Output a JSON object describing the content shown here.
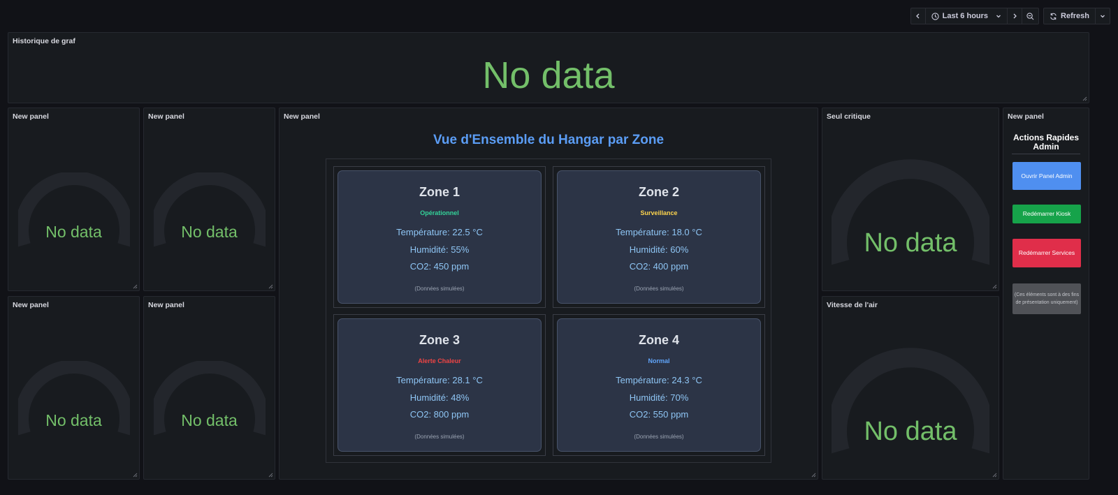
{
  "toolbar": {
    "time_range": "Last 6 hours",
    "refresh_label": "Refresh"
  },
  "no_data": "No data",
  "panels": {
    "history": {
      "title": "Historique de graf"
    },
    "gauge1": {
      "title": "New panel"
    },
    "gauge2": {
      "title": "New panel"
    },
    "gauge3": {
      "title": "New panel"
    },
    "gauge4": {
      "title": "New panel"
    },
    "overview": {
      "title": "New panel"
    },
    "critical": {
      "title": "Seul critique"
    },
    "airspeed": {
      "title": "Vitesse de l'air"
    },
    "admin": {
      "title": "New panel"
    }
  },
  "overview": {
    "heading": "Vue d'Ensemble du Hangar par Zone",
    "zones": [
      {
        "name": "Zone 1",
        "status": "Opérationnel",
        "status_color": "#34d399",
        "temperature": "Température: 22.5 °C",
        "humidity": "Humidité: 55%",
        "co2": "CO2: 450 ppm",
        "note": "(Données simulées)"
      },
      {
        "name": "Zone 2",
        "status": "Surveillance",
        "status_color": "#fcd34d",
        "temperature": "Température: 18.0 °C",
        "humidity": "Humidité: 60%",
        "co2": "CO2: 400 ppm",
        "note": "(Données simulées)"
      },
      {
        "name": "Zone 3",
        "status": "Alerte Chaleur",
        "status_color": "#ef4444",
        "temperature": "Température: 28.1 °C",
        "humidity": "Humidité: 48%",
        "co2": "CO2: 800 ppm",
        "note": "(Données simulées)"
      },
      {
        "name": "Zone 4",
        "status": "Normal",
        "status_color": "#60a5fa",
        "temperature": "Température: 24.3 °C",
        "humidity": "Humidité: 70%",
        "co2": "CO2: 550 ppm",
        "note": "(Données simulées)"
      }
    ]
  },
  "admin": {
    "title": "Actions Rapides Admin",
    "open_panel": "Ouvrir Panel Admin",
    "restart_kiosk": "Redémarrer Kiosk",
    "restart_services": "Redémarrer Services",
    "note": "(Ces éléments sont à des fins de présentation uniquement)"
  },
  "colors": {
    "no_data_green": "#73bf69",
    "heading_blue": "#5b9df5",
    "btn_blue": "#4f8ff0",
    "btn_green": "#16a34a",
    "btn_red": "#e02e4a"
  }
}
